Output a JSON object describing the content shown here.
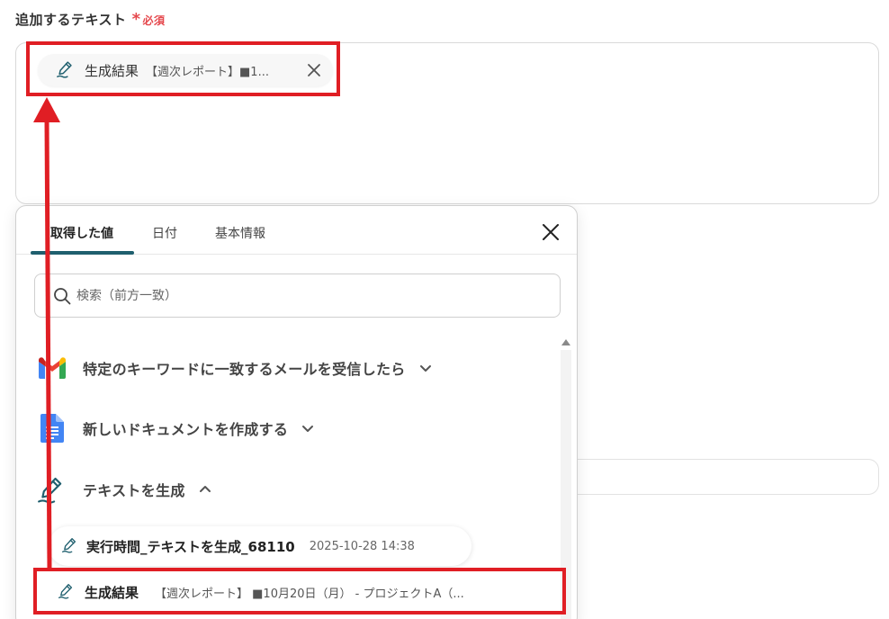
{
  "field": {
    "label": "追加するテキスト",
    "required_mark": "*",
    "required_text": "必須"
  },
  "chip": {
    "name": "生成結果",
    "preview": "【週次レポート】■1...",
    "icon": "pen-icon"
  },
  "panel": {
    "tabs": [
      {
        "label": "取得した値",
        "active": true
      },
      {
        "label": "日付",
        "active": false
      },
      {
        "label": "基本情報",
        "active": false
      }
    ],
    "search_placeholder": "検索（前方一致）",
    "groups": [
      {
        "label": "特定のキーワードに一致するメールを受信したら",
        "icon": "gmail-icon",
        "expanded": false
      },
      {
        "label": "新しいドキュメントを作成する",
        "icon": "google-docs-icon",
        "expanded": false
      },
      {
        "label": "テキストを生成",
        "icon": "pen-icon",
        "expanded": true
      }
    ],
    "items": [
      {
        "name": "実行時間_テキストを生成_68110",
        "value": "2025-10-28 14:38"
      },
      {
        "name": "生成結果",
        "value": "【週次レポート】 ■10月20日（月） - プロジェクトA（..."
      }
    ]
  },
  "colors": {
    "accent_tab": "#1f5f6e",
    "annotation_red": "#e01e24",
    "required_red": "#e5484d"
  }
}
